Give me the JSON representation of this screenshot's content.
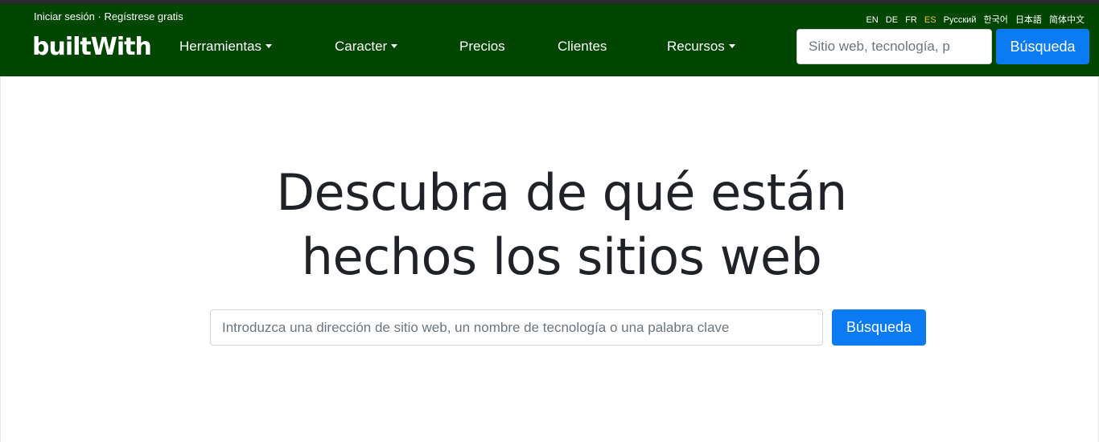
{
  "header": {
    "auth": {
      "login": "Iniciar sesión",
      "separator": " · ",
      "register": "Regístrese gratis"
    },
    "languages": [
      {
        "code": "EN",
        "active": false
      },
      {
        "code": "DE",
        "active": false
      },
      {
        "code": "FR",
        "active": false
      },
      {
        "code": "ES",
        "active": true
      },
      {
        "code": "Русский",
        "active": false
      },
      {
        "code": "한국어",
        "active": false
      },
      {
        "code": "日本語",
        "active": false
      },
      {
        "code": "简体中文",
        "active": false
      }
    ],
    "logo_text": "builtWith",
    "nav": [
      {
        "label": "Herramientas",
        "dropdown": true
      },
      {
        "label": "Caracter",
        "dropdown": true
      },
      {
        "label": "Precios",
        "dropdown": false
      },
      {
        "label": "Clientes",
        "dropdown": false
      },
      {
        "label": "Recursos",
        "dropdown": true
      }
    ],
    "search": {
      "placeholder": "Sitio web, tecnología, p",
      "button_label": "Búsqueda"
    },
    "colors": {
      "nav_bg": "#004500",
      "active_lang": "#f4c430",
      "button": "#0b7bf4"
    }
  },
  "hero": {
    "title_line1": "Descubra de qué están",
    "title_line2": "hechos los sitios web",
    "search": {
      "placeholder": "Introduzca una dirección de sitio web, un nombre de tecnología o una palabra clave",
      "button_label": "Búsqueda"
    }
  }
}
